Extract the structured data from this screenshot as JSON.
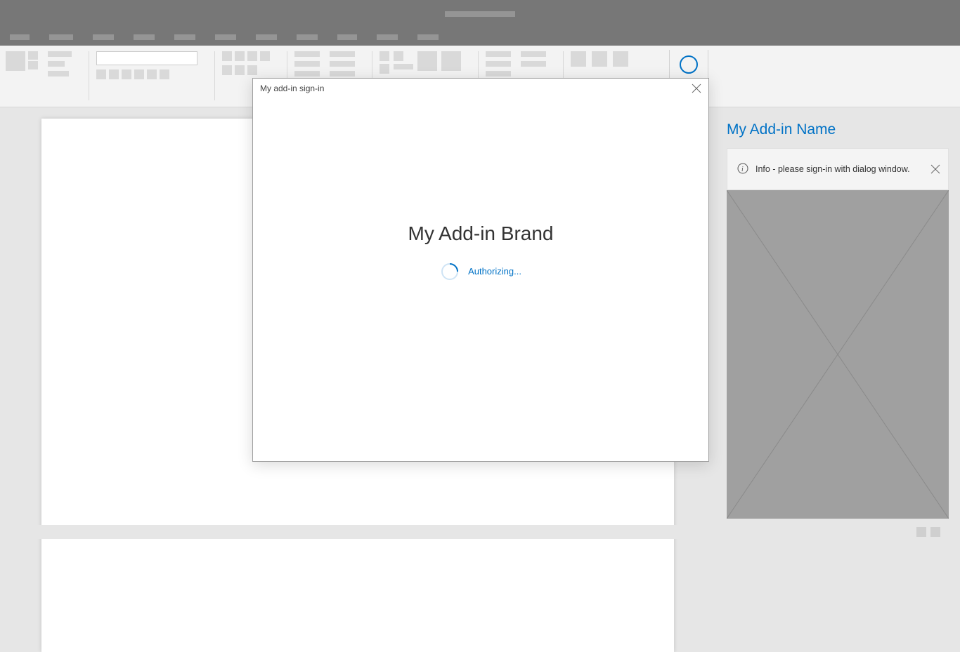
{
  "taskpane": {
    "title": "My Add-in Name",
    "info_message": "Info - please sign-in with dialog window."
  },
  "dialog": {
    "title": "My add-in sign-in",
    "brand": "My Add-in Brand",
    "status": "Authorizing..."
  }
}
